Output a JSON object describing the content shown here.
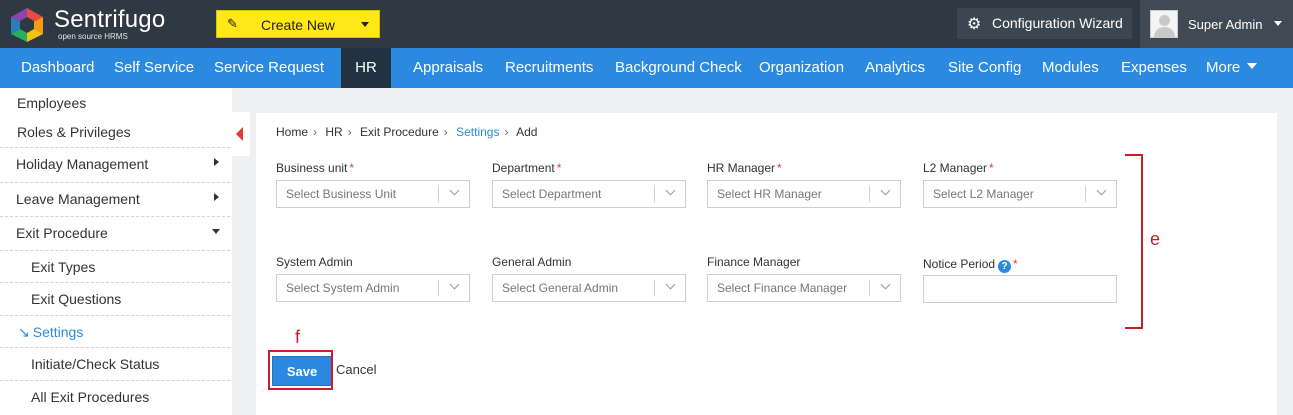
{
  "brand": {
    "name": "Sentrifugo",
    "tagline": "open source HRMS"
  },
  "topbar": {
    "create_label": "Create New",
    "config_label": "Configuration Wizard",
    "user_name": "Super Admin"
  },
  "nav": {
    "items": [
      "Dashboard",
      "Self Service",
      "Service Request",
      "HR",
      "Appraisals",
      "Recruitments",
      "Background Check",
      "Organization",
      "Analytics",
      "Site Config",
      "Modules",
      "Expenses",
      "More"
    ],
    "active": "HR"
  },
  "sidebar": {
    "items": [
      {
        "label": "Employees"
      },
      {
        "label": "Roles & Privileges"
      },
      {
        "label": "Holiday Management"
      },
      {
        "label": "Leave Management"
      },
      {
        "label": "Exit Procedure"
      },
      {
        "label": "Exit Types"
      },
      {
        "label": "Exit Questions"
      },
      {
        "label": "Settings",
        "prefix": "↘"
      },
      {
        "label": "Initiate/Check Status"
      },
      {
        "label": "All Exit Procedures"
      }
    ]
  },
  "breadcrumb": [
    "Home",
    "HR",
    "Exit Procedure",
    "Settings",
    "Add"
  ],
  "form": {
    "fields": [
      {
        "label": "Business unit",
        "required": "*",
        "placeholder": "Select Business Unit"
      },
      {
        "label": "Department",
        "required": "*",
        "placeholder": "Select Department"
      },
      {
        "label": "HR Manager",
        "required": "*",
        "placeholder": "Select HR Manager"
      },
      {
        "label": "L2 Manager",
        "required": "*",
        "placeholder": "Select L2 Manager"
      },
      {
        "label": "System Admin",
        "placeholder": "Select System Admin"
      },
      {
        "label": "General Admin",
        "placeholder": "Select General Admin"
      },
      {
        "label": "Finance Manager",
        "placeholder": "Select Finance Manager"
      }
    ],
    "notice": {
      "label": "Notice Period",
      "help": "?",
      "required": "*",
      "value": ""
    },
    "save_label": "Save",
    "cancel_label": "Cancel"
  },
  "annotations": {
    "e": "e",
    "f": "f"
  }
}
